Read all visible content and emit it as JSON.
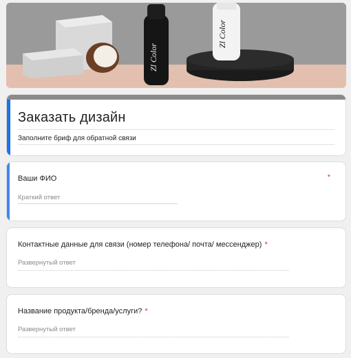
{
  "banner": {
    "brand_text_1": "Zl Color",
    "brand_text_2": "Zl Color"
  },
  "form": {
    "title": "Заказать дизайн",
    "description": "Заполните бриф для обратной связи",
    "accent_color": "#1a73e8",
    "required_color": "#d93025"
  },
  "questions": [
    {
      "title": "Ваши ФИО",
      "required_mark": "*",
      "placeholder": "Краткий ответ",
      "type": "short"
    },
    {
      "title": "Контактные данные для связи (номер телефона/ почта/ мессенджер)",
      "required_mark": "*",
      "placeholder": "Развернутый ответ",
      "type": "paragraph"
    },
    {
      "title": "Название продукта/бренда/услуги?",
      "required_mark": "*",
      "placeholder": "Развернутый ответ",
      "type": "paragraph"
    }
  ]
}
